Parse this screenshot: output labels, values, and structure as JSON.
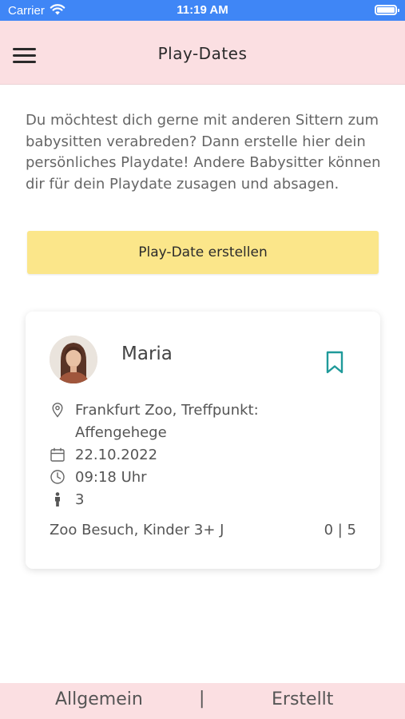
{
  "status_bar": {
    "carrier": "Carrier",
    "time": "11:19 AM"
  },
  "header": {
    "title": "Play-Dates"
  },
  "intro": {
    "text": "Du möchtest dich gerne mit anderen Sittern zum babysitten verabreden? Dann erstelle hier dein persönliches Playdate! Andere Babysitter können dir für dein Playdate zusagen und absagen."
  },
  "create_button": {
    "label": "Play-Date erstellen",
    "color": "#fbe68a"
  },
  "playdate_card": {
    "name": "Maria",
    "location": "Frankfurt Zoo, Treffpunkt: Affengehege",
    "date": "22.10.2022",
    "time": "09:18 Uhr",
    "children": "3",
    "description": "Zoo Besuch, Kinder 3+ J",
    "participants": "0 | 5"
  },
  "tab_bar": {
    "left": "Allgemein",
    "separator": "|",
    "right": "Erstellt"
  },
  "colors": {
    "status_bar": "#3f86f6",
    "header_bg": "#fbdfe2",
    "accent_teal": "#1f9a9a"
  },
  "icons": [
    "menu-icon",
    "bookmark-icon",
    "location-pin-icon",
    "calendar-icon",
    "clock-icon",
    "person-icon",
    "wifi-icon",
    "battery-icon"
  ]
}
